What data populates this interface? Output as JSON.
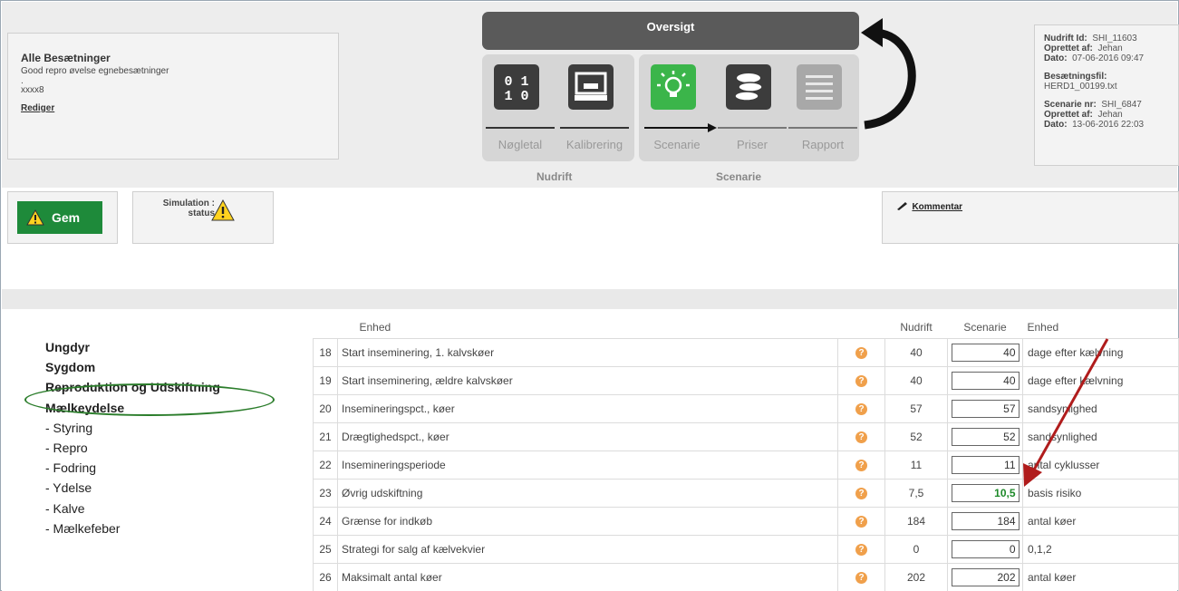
{
  "herd": {
    "title": "Alle Besætninger",
    "subtitle": "Good repro øvelse egnebesætninger",
    "dot": ".",
    "code": "xxxx8",
    "edit_label": "Rediger"
  },
  "overview": {
    "title": "Oversigt"
  },
  "steps": {
    "noegletal": {
      "label": "Nøgletal",
      "icon": "binary-icon"
    },
    "kalibrering": {
      "label": "Kalibrering",
      "icon": "monitor-icon"
    },
    "scenarie": {
      "label": "Scenarie",
      "icon": "lightbulb-icon"
    },
    "priser": {
      "label": "Priser",
      "icon": "coins-icon"
    },
    "rapport": {
      "label": "Rapport",
      "icon": "list-icon"
    }
  },
  "groups": {
    "nudrift": "Nudrift",
    "scenarie": "Scenarie"
  },
  "info": {
    "nudrift_id_label": "Nudrift Id:",
    "nudrift_id": "SHI_11603",
    "created_by_label": "Oprettet af:",
    "created_by": "Jehan",
    "date_label": "Dato:",
    "date": "07-06-2016 09:47",
    "file_label": "Besætningsfil:",
    "file": "HERD1_00199.txt",
    "scenario_nr_label": "Scenarie nr:",
    "scenario_nr": "SHI_6847",
    "scenario_created_by": "Jehan",
    "scenario_date": "13-06-2016 22:03"
  },
  "gem": {
    "label": "Gem"
  },
  "simulation": {
    "label": "Simulation : status"
  },
  "comment": {
    "label": "Kommentar"
  },
  "sidebar": [
    {
      "label": "Ungdyr",
      "bold": true
    },
    {
      "label": "Sygdom",
      "bold": true
    },
    {
      "label": "Reproduktion og Udskiftning",
      "bold": true
    },
    {
      "label": "Mælkeydelse",
      "bold": true
    },
    {
      "label": "- Styring",
      "bold": false
    },
    {
      "label": "- Repro",
      "bold": false
    },
    {
      "label": "- Fodring",
      "bold": false
    },
    {
      "label": "- Ydelse",
      "bold": false
    },
    {
      "label": "- Kalve",
      "bold": false
    },
    {
      "label": "- Mælkefeber",
      "bold": false
    }
  ],
  "table": {
    "headers": {
      "desc": "Enhed",
      "nudrift": "Nudrift",
      "scenarie": "Scenarie",
      "unit": "Enhed"
    },
    "rows": [
      {
        "n": "18",
        "desc": "Start inseminering, 1. kalvskøer",
        "nud": "40",
        "scn": "40",
        "unit": "dage efter kælvning"
      },
      {
        "n": "19",
        "desc": "Start inseminering, ældre kalvskøer",
        "nud": "40",
        "scn": "40",
        "unit": "dage efter kælvning"
      },
      {
        "n": "20",
        "desc": "Insemineringspct., køer",
        "nud": "57",
        "scn": "57",
        "unit": "sandsynlighed"
      },
      {
        "n": "21",
        "desc": "Drægtighedspct., køer",
        "nud": "52",
        "scn": "52",
        "unit": "sandsynlighed"
      },
      {
        "n": "22",
        "desc": "Insemineringsperiode",
        "nud": "11",
        "scn": "11",
        "unit": "antal cyklusser"
      },
      {
        "n": "23",
        "desc": "Øvrig udskiftning",
        "nud": "7,5",
        "scn": "10,5",
        "unit": "basis risiko",
        "highlight": true
      },
      {
        "n": "24",
        "desc": "Grænse for indkøb",
        "nud": "184",
        "scn": "184",
        "unit": "antal køer"
      },
      {
        "n": "25",
        "desc": "Strategi for salg af kælvekvier",
        "nud": "0",
        "scn": "0",
        "unit": "0,1,2"
      },
      {
        "n": "26",
        "desc": "Maksimalt antal køer",
        "nud": "202",
        "scn": "202",
        "unit": "antal køer"
      }
    ]
  },
  "colors": {
    "accent_green": "#1e8a3a",
    "warning": "#f0a04b",
    "annotation_red": "#b01c1c",
    "ellipse_green": "#2b7d2b"
  }
}
